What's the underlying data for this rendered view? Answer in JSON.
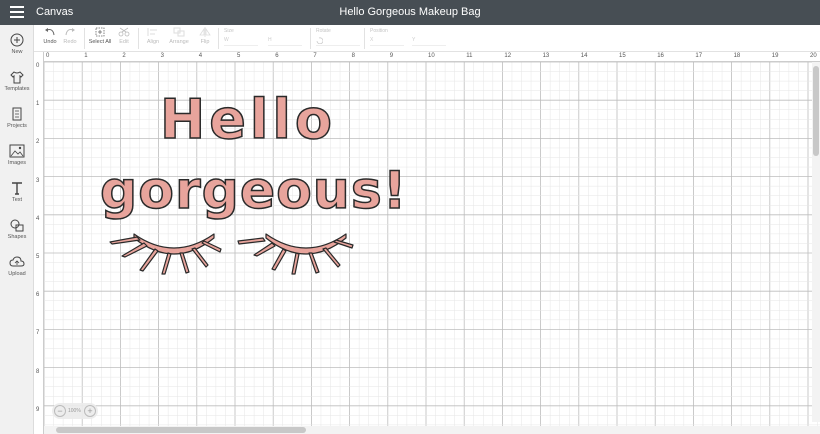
{
  "header": {
    "app_title": "Canvas",
    "project_title": "Hello Gorgeous Makeup Bag"
  },
  "sidebar": {
    "items": [
      {
        "label": "New",
        "icon": "plus-circle-icon"
      },
      {
        "label": "Templates",
        "icon": "tshirt-icon"
      },
      {
        "label": "Projects",
        "icon": "projects-icon"
      },
      {
        "label": "Images",
        "icon": "image-icon"
      },
      {
        "label": "Text",
        "icon": "text-icon"
      },
      {
        "label": "Shapes",
        "icon": "shapes-icon"
      },
      {
        "label": "Upload",
        "icon": "upload-cloud-icon"
      }
    ]
  },
  "toolbar": {
    "undo": "Undo",
    "redo": "Redo",
    "select_all": "Select All",
    "edit": "Edit",
    "align": "Align",
    "arrange": "Arrange",
    "flip": "Flip",
    "size_label": "Size",
    "size_w": "W",
    "size_h": "H",
    "rotate_label": "Rotate",
    "position_label": "Position",
    "pos_x": "X",
    "pos_y": "Y"
  },
  "rulers": {
    "top": [
      "0",
      "1",
      "2",
      "3",
      "4",
      "5",
      "6",
      "7",
      "8",
      "9",
      "10",
      "11",
      "12",
      "13",
      "14",
      "15",
      "16",
      "17",
      "18",
      "19",
      "20"
    ],
    "left": [
      "0",
      "1",
      "2",
      "3",
      "4",
      "5",
      "6",
      "7",
      "8",
      "9"
    ]
  },
  "design": {
    "line1": "Hello",
    "line2": "gorgeous!",
    "fill_color": "#e8a49c",
    "stroke_color": "#2a2a2a"
  },
  "zoom": {
    "minus": "−",
    "value": "100%",
    "plus": "+"
  },
  "colors": {
    "header_bg": "#474e54",
    "grid_major": "#bdbdbd",
    "grid_minor": "#e6e6e6"
  }
}
